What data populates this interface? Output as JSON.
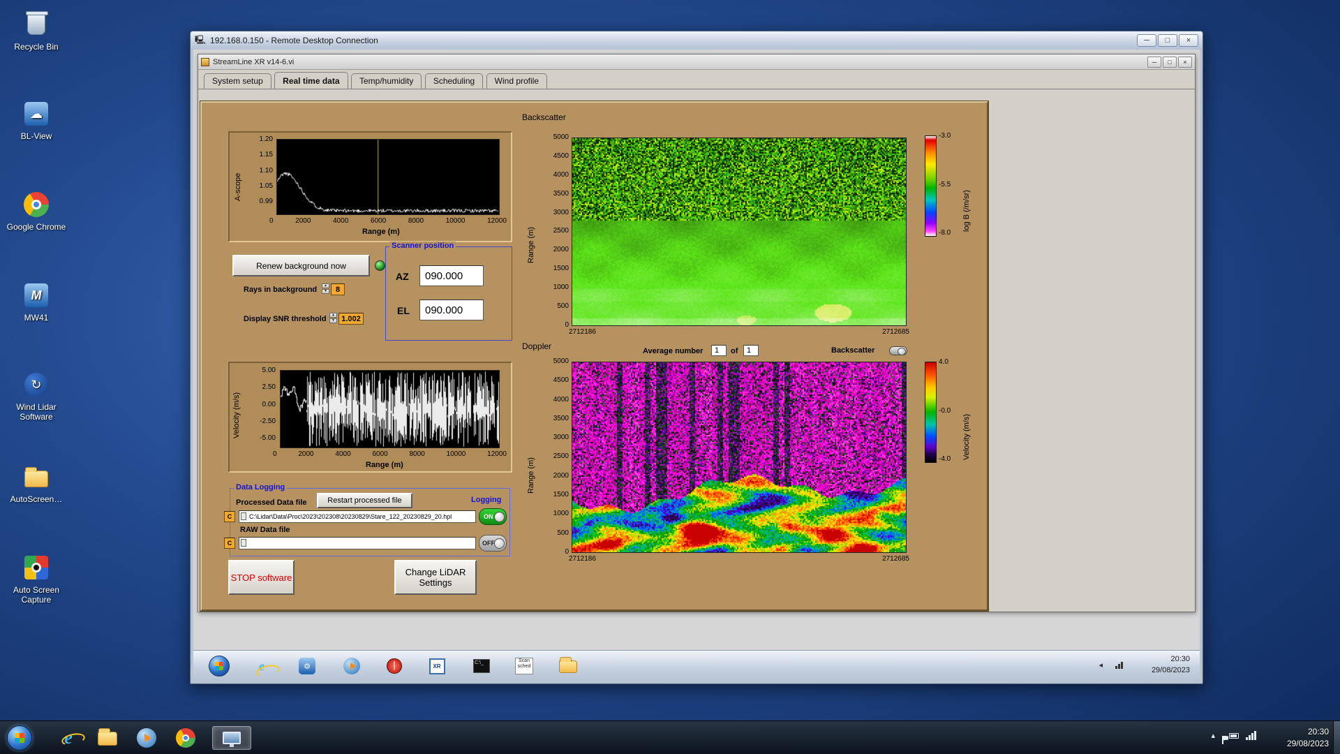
{
  "chart_data": [
    {
      "type": "line",
      "title": "A-scope",
      "xlabel": "Range (m)",
      "ylabel": "A-scope",
      "xlim": [
        0,
        12000
      ],
      "ylim": [
        0.99,
        1.2
      ],
      "description": "White signal trace peaking near 1.10 at ~500 m, decaying to a ~1.00 noise floor by 3000 m; yellow cursor near 5500 m.",
      "cursor_x": 5500
    },
    {
      "type": "heatmap",
      "title": "Backscatter",
      "ylabel": "Range (m)",
      "ylim": [
        0,
        5000
      ],
      "x_left": "2712186",
      "x_right": "2712685",
      "colorbar": {
        "label": "log B (/m/sr)",
        "range": [
          -8.0,
          -3.0
        ]
      },
      "description": "Speckled yellow-green noise above ~2800 m, smooth green boundary-layer return below, brightening toward the ground."
    },
    {
      "type": "line",
      "title": "Velocity",
      "xlabel": "Range (m)",
      "ylabel": "Velocity (m/s)",
      "xlim": [
        0,
        12000
      ],
      "ylim": [
        -5,
        5
      ],
      "description": "Coherent trace below ~1500 m, full-scale noise beyond."
    },
    {
      "type": "heatmap",
      "title": "Doppler",
      "ylabel": "Range (m)",
      "ylim": [
        0,
        5000
      ],
      "x_left": "2712186",
      "x_right": "2712685",
      "colorbar": {
        "label": "Velocity (m/s)",
        "range": [
          -4.0,
          4.0
        ]
      },
      "description": "Magenta folded-velocity noise above ~1500 m; turbulent green/yellow/red/blue velocity field in the boundary layer below."
    }
  ],
  "desktop": {
    "icons": [
      {
        "label": "Recycle Bin"
      },
      {
        "label": "BL-View"
      },
      {
        "label": "Google Chrome"
      },
      {
        "label": "MW41"
      },
      {
        "label": "Wind Lidar Software"
      },
      {
        "label": "AutoScreen…"
      },
      {
        "label": "Auto Screen Capture"
      }
    ]
  },
  "rdp": {
    "title": "192.168.0.150 - Remote Desktop Connection"
  },
  "app": {
    "title": "StreamLine XR v14-6.vi",
    "tabs": [
      {
        "label": "System setup"
      },
      {
        "label": "Real time data"
      },
      {
        "label": "Temp/humidity"
      },
      {
        "label": "Scheduling"
      },
      {
        "label": "Wind profile"
      }
    ],
    "ascope": {
      "ylabel": "A-scope",
      "xlabel": "Range (m)",
      "yticks": [
        "1.20",
        "1.15",
        "1.10",
        "1.05",
        "0.99"
      ],
      "xticks": [
        "0",
        "2000",
        "4000",
        "6000",
        "8000",
        "10000",
        "12000"
      ]
    },
    "velocity_plot": {
      "ylabel": "Velocity (m/s)",
      "xlabel": "Range (m)",
      "yticks": [
        "5.00",
        "2.50",
        "0.00",
        "-2.50",
        "-5.00"
      ],
      "xticks": [
        "0",
        "2000",
        "4000",
        "6000",
        "8000",
        "10000",
        "12000"
      ]
    },
    "backscatter": {
      "title": "Backscatter",
      "ylabel": "Range (m)",
      "yticks": [
        "5000",
        "4500",
        "4000",
        "3500",
        "3000",
        "2500",
        "2000",
        "1500",
        "1000",
        "500",
        "0"
      ],
      "x_left": "2712186",
      "x_right": "2712685",
      "cb_label": "log B (/m/sr)",
      "cb_ticks": [
        "-3.0",
        "-5.5",
        "-8.0"
      ]
    },
    "doppler": {
      "title": "Doppler",
      "ylabel": "Range (m)",
      "yticks": [
        "5000",
        "4500",
        "4000",
        "3500",
        "3000",
        "2500",
        "2000",
        "1500",
        "1000",
        "500",
        "0"
      ],
      "x_left": "2712186",
      "x_right": "2712685",
      "cb_label": "Velocity (m/s)",
      "cb_ticks": [
        "4.0",
        "-0.0",
        "-4.0"
      ],
      "average_label": "Average number",
      "avg_value": "1",
      "of_label": "of",
      "avg_total": "1",
      "toggle_label": "Backscatter"
    },
    "controls": {
      "renew": "Renew background now",
      "rays_label": "Rays in background",
      "rays_value": "8",
      "snr_label": "Display SNR threshold",
      "snr_value": "1.002",
      "scanner_title": "Scanner position",
      "az_label": "AZ",
      "az_value": "090.000",
      "el_label": "EL",
      "el_value": "090.000"
    },
    "logging": {
      "section": "Data Logging",
      "processed_label": "Processed Data file",
      "restart": "Restart processed file",
      "logging_label": "Logging",
      "drive": "C",
      "processed_path": "C:\\Lidar\\Data\\Proc\\2023\\202308\\20230829\\Stare_122_20230829_20.hpl",
      "on": "ON",
      "raw_label": "RAW Data file",
      "raw_path": "",
      "off": "OFF"
    },
    "stop_button": "STOP software",
    "change_button": "Change LiDAR Settings"
  },
  "remote_taskbar": {
    "time": "20:30",
    "date": "29/08/2023",
    "scan_icon_text": "Scan sched",
    "xr_icon_text": "XR"
  },
  "taskbar": {
    "time": "20:30",
    "date": "29/08/2023"
  }
}
